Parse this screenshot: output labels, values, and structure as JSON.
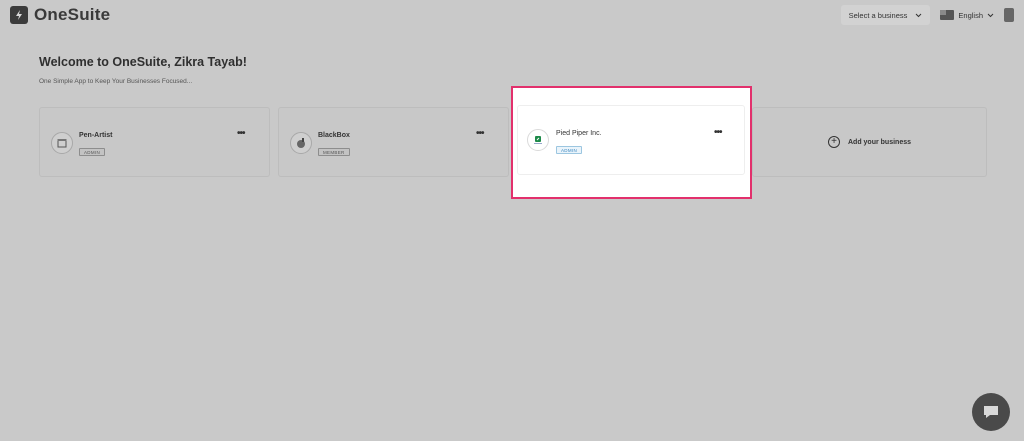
{
  "app": {
    "name": "OneSuite"
  },
  "header": {
    "select_business": "Select a business",
    "language": "English"
  },
  "welcome": {
    "title": "Welcome to OneSuite, Zikra Tayab!",
    "subtitle": "One Simple App to Keep Your Businesses Focused..."
  },
  "businesses": [
    {
      "name": "Pen-Artist",
      "role": "ADMIN",
      "icon": "storefront-icon"
    },
    {
      "name": "BlackBox",
      "role": "MEMBER",
      "icon": "blackbox-logo-icon"
    },
    {
      "name": "Pied Piper Inc.",
      "role": "ADMIN",
      "icon": "pied-piper-logo-icon"
    }
  ],
  "add_business": {
    "label": "Add your business"
  },
  "colors": {
    "highlight": "#e2306c",
    "admin_badge": "#3a87c0",
    "background": "#c9c9c9"
  }
}
